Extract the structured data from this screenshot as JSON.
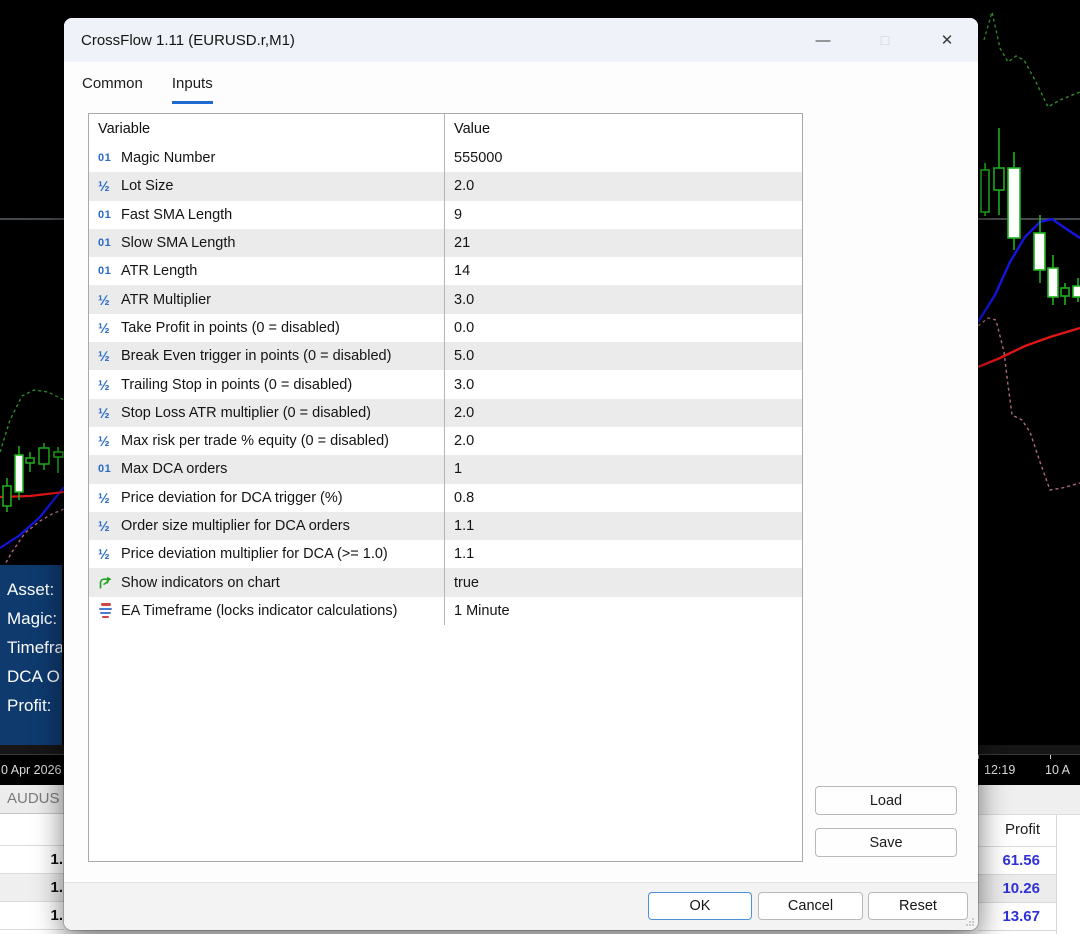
{
  "dialog": {
    "title": "CrossFlow 1.11 (EURUSD.r,M1)",
    "window_controls": {
      "minimize_glyph": "—",
      "maximize_glyph": "□",
      "close_glyph": "✕"
    },
    "tabs": [
      {
        "label": "Common",
        "active": false
      },
      {
        "label": "Inputs",
        "active": true
      }
    ],
    "table": {
      "columns": {
        "variable": "Variable",
        "value": "Value"
      },
      "rows": [
        {
          "icon": "int",
          "label": "Magic Number",
          "value": "555000"
        },
        {
          "icon": "double",
          "label": "Lot Size",
          "value": "2.0"
        },
        {
          "icon": "int",
          "label": "Fast SMA Length",
          "value": "9"
        },
        {
          "icon": "int",
          "label": "Slow SMA Length",
          "value": "21"
        },
        {
          "icon": "int",
          "label": "ATR Length",
          "value": "14"
        },
        {
          "icon": "double",
          "label": "ATR Multiplier",
          "value": "3.0"
        },
        {
          "icon": "double",
          "label": "Take Profit in points (0 = disabled)",
          "value": "0.0"
        },
        {
          "icon": "double",
          "label": "Break Even trigger in points (0 = disabled)",
          "value": "5.0"
        },
        {
          "icon": "double",
          "label": "Trailing Stop in points (0 = disabled)",
          "value": "3.0"
        },
        {
          "icon": "double",
          "label": "Stop Loss ATR multiplier (0 = disabled)",
          "value": "2.0"
        },
        {
          "icon": "double",
          "label": "Max risk per trade % equity (0 = disabled)",
          "value": "2.0"
        },
        {
          "icon": "int",
          "label": "Max DCA orders",
          "value": "1"
        },
        {
          "icon": "double",
          "label": "Price deviation for DCA trigger (%)",
          "value": "0.8"
        },
        {
          "icon": "double",
          "label": "Order size multiplier for DCA orders",
          "value": "1.1"
        },
        {
          "icon": "double",
          "label": "Price deviation multiplier for DCA (>= 1.0)",
          "value": "1.1"
        },
        {
          "icon": "bool",
          "label": "Show indicators on chart",
          "value": "true"
        },
        {
          "icon": "enum",
          "label": "EA Timeframe (locks indicator calculations)",
          "value": "1 Minute"
        }
      ],
      "icon_glyphs": {
        "int": "01",
        "double": "½"
      }
    },
    "buttons": {
      "load": "Load",
      "save": "Save",
      "ok": "OK",
      "cancel": "Cancel",
      "reset": "Reset"
    }
  },
  "background": {
    "info_panel_lines": [
      "Asset:",
      "Magic:",
      "Timefra",
      "DCA O",
      "Profit:"
    ],
    "time_axis": {
      "left_date": "0 Apr 2026",
      "time_1": "12:19",
      "time_2": "10 A"
    },
    "left_table": {
      "header": "AUDUS",
      "cells": [
        "1.",
        "1.",
        "1."
      ]
    },
    "profit_table": {
      "header": "Profit",
      "values": [
        "61.56",
        "10.26",
        "13.67"
      ]
    }
  },
  "colors": {
    "accent_blue": "#1f6ad0",
    "profit_blue": "#3030d8",
    "panel_navy": "#0e3a6e",
    "candle_green": "#1db31d",
    "band_green_dashed": "#2e8b2e",
    "ma_blue": "#1515e0",
    "ma_red": "#e01515",
    "band_pink_dashed": "#b06a7a",
    "type_icon_blue": "#2a6bc8",
    "bool_icon_green": "#1fa11f"
  }
}
